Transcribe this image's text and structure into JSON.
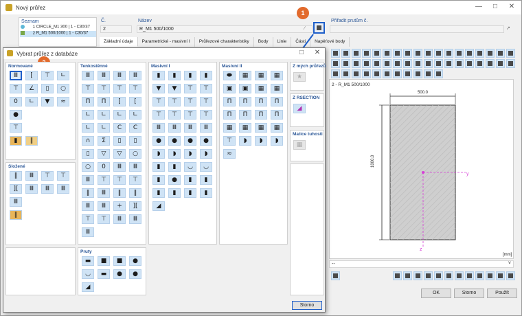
{
  "main": {
    "title": "Nový průřez",
    "list_label": "Seznam",
    "list_items": [
      {
        "num": "1",
        "text": "CIRCLE_M1 300 | 1 - C30/37",
        "color": "#5fb8d8"
      },
      {
        "num": "2",
        "text": "R_M1 500/1000 | 1 - C30/37",
        "color": "#7aa84a"
      }
    ],
    "no_label": "Č.",
    "no_value": "2",
    "name_label": "Název",
    "name_value": "R_M1 500/1000",
    "assign_label": "Přiřadit prutům č.",
    "tabs": [
      "Základní údaje",
      "Parametrické - masivní I",
      "Průřezové charakteristiky",
      "Body",
      "Linie",
      "Části",
      "Napěťové body"
    ],
    "section_caption": "2 - R_M1 500/1000",
    "dim_width": "500.0",
    "dim_height": "1000.0",
    "axis_y": "y",
    "axis_z": "z",
    "units": "[mm]",
    "dropdown_value": "--",
    "ok": "OK",
    "cancel": "Storno",
    "apply": "Použít"
  },
  "dialog": {
    "title": "Vybrat průřez z databáze",
    "sections": {
      "normovane": "Normované",
      "tenkostenne": "Tenkostěnné",
      "masivni_i": "Masivní I",
      "masivni_ii": "Masivní II",
      "z_mych": "Z mých průřezů",
      "z_rsection": "Z RSECTION",
      "matice": "Matice tuhosti",
      "slozene": "Složené",
      "pruty": "Pruty"
    },
    "cancel": "Storno"
  },
  "callouts": [
    "1",
    "2"
  ],
  "colors": {
    "accent": "#1f5fc9",
    "callout": "#e26a2c",
    "button_fill": "#cfe3f5"
  }
}
